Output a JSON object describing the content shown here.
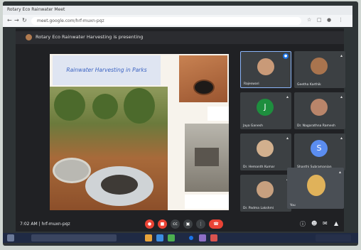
{
  "browser": {
    "tab_title": "Rotary Eco Rainwater Meet",
    "url": "meet.google.com/hrf-muxn-pqz"
  },
  "presenting": {
    "text": "Rotary Eco Rainwater Harvesting is presenting"
  },
  "slide": {
    "title": "Rainwater Harvesting in Parks"
  },
  "participants": [
    {
      "name": "Rajeswari",
      "initial": ""
    },
    {
      "name": "Geetha Karthik",
      "initial": ""
    },
    {
      "name": "Jaya Ganesh",
      "initial": "J"
    },
    {
      "name": "Dr. Nagarathna Ramesh",
      "initial": ""
    },
    {
      "name": "Dr. Hemanth Kumar",
      "initial": ""
    },
    {
      "name": "Shanthi Subramanian",
      "initial": "S"
    },
    {
      "name": "Dr. Padma Lakshmi",
      "initial": ""
    },
    {
      "name": "You",
      "initial": ""
    }
  ],
  "bottom": {
    "time": "7:02 AM",
    "meeting_code": "hrf-muxn-pqz"
  },
  "icons": {
    "mic_off": "mic-off-icon",
    "cam_off": "camera-off-icon",
    "captions": "captions-icon",
    "present": "present-icon",
    "more": "more-icon",
    "end_call": "end-call-icon",
    "info": "info-icon",
    "people": "people-icon",
    "chat": "chat-icon",
    "activities": "activities-icon"
  },
  "colors": {
    "meet_background": "#202124",
    "danger_red": "#ea4335",
    "accent_blue": "#1a73e8"
  }
}
